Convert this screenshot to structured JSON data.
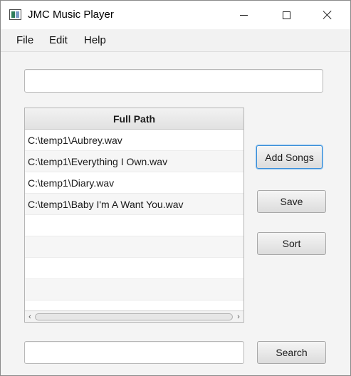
{
  "window": {
    "title": "JMC Music Player"
  },
  "menu": {
    "items": [
      "File",
      "Edit",
      "Help"
    ]
  },
  "top_input": {
    "value": "",
    "placeholder": ""
  },
  "table": {
    "columns": [
      "Full Path"
    ],
    "rows": [
      "C:\\temp1\\Aubrey.wav",
      "C:\\temp1\\Everything I Own.wav",
      "C:\\temp1\\Diary.wav",
      "C:\\temp1\\Baby I'm A Want You.wav"
    ]
  },
  "buttons": {
    "add_songs": "Add Songs",
    "save": "Save",
    "sort": "Sort",
    "search": "Search"
  },
  "search_input": {
    "value": "",
    "placeholder": ""
  },
  "colors": {
    "window_bg": "#f4f4f4",
    "focus_ring": "#3b8ed8",
    "row_alt": "#f6f6f6"
  },
  "icons": {
    "app": "music-player-app-icon",
    "minimize": "minimize-icon",
    "maximize": "maximize-icon",
    "close": "close-icon",
    "scroll_left": "chevron-left-icon",
    "scroll_right": "chevron-right-icon"
  }
}
